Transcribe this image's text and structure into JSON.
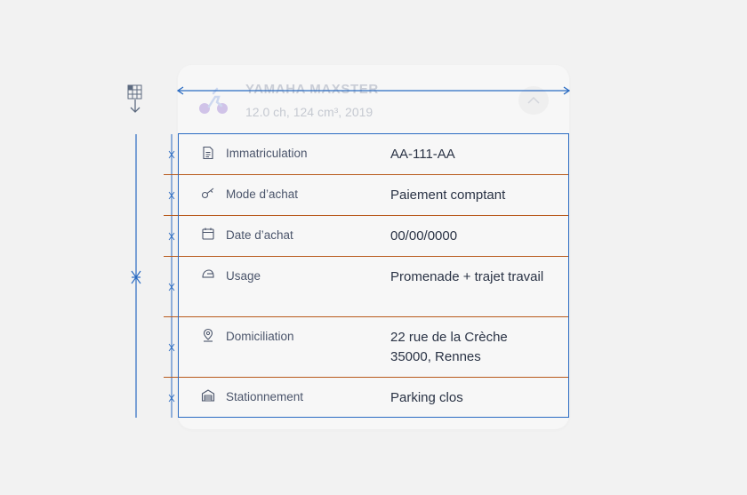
{
  "vehicle": {
    "name": "YAMAHA MAXSTER",
    "details": "12.0 ch, 124 cm³, 2019",
    "icon": "scooter-icon",
    "collapse_icon": "chevron-up-icon"
  },
  "rows": [
    {
      "icon": "document-icon",
      "label": "Immatriculation",
      "value": "AA-111-AA"
    },
    {
      "icon": "key-icon",
      "label": "Mode d’achat",
      "value": "Paiement comptant"
    },
    {
      "icon": "calendar-icon",
      "label": "Date d’achat",
      "value": "00/00/0000"
    },
    {
      "icon": "helmet-icon",
      "label": "Usage",
      "value": "Promenade + trajet travail"
    },
    {
      "icon": "location-pin-icon",
      "label": "Domiciliation",
      "value": "22 rue de la Crèche 35000, Rennes"
    },
    {
      "icon": "garage-icon",
      "label": "Stationnement",
      "value": "Parking clos"
    }
  ],
  "colors": {
    "background": "#f2f2f2",
    "card": "#f7f7f7",
    "label": "#4b556b",
    "value": "#2a3345",
    "separator": "#b85a1c",
    "guide": "#2a6bc2"
  },
  "annotation_icons": [
    "table-grid-icon",
    "arrow-down-icon"
  ]
}
